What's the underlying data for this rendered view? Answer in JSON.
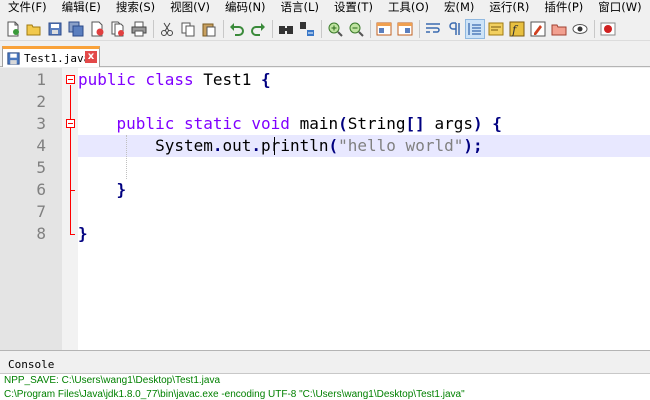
{
  "menu": [
    "文件(F)",
    "编辑(E)",
    "搜索(S)",
    "视图(V)",
    "编码(N)",
    "语言(L)",
    "设置(T)",
    "工具(O)",
    "宏(M)",
    "运行(R)",
    "插件(P)",
    "窗口(W)",
    "?"
  ],
  "toolbar": {
    "icons": [
      "new-file-icon",
      "open-file-icon",
      "save-icon",
      "save-all-icon",
      "close-icon",
      "close-all-icon",
      "print-icon",
      "cut-icon",
      "copy-icon",
      "paste-icon",
      "undo-icon",
      "redo-icon",
      "find-icon",
      "replace-icon",
      "zoom-in-icon",
      "zoom-out-icon",
      "sync-vertical-icon",
      "sync-horizontal-icon",
      "word-wrap-icon",
      "show-all-chars-icon",
      "indent-guide-icon",
      "user-language-icon",
      "function-list-icon",
      "folder-workspace-icon",
      "doc-map-icon",
      "monitor-icon",
      "record-macro-icon"
    ]
  },
  "tab": {
    "label": "Test1.java",
    "close_glyph": "x"
  },
  "editor": {
    "line_numbers": [
      "1",
      "2",
      "3",
      "4",
      "5",
      "6",
      "7",
      "8"
    ],
    "lines": [
      [
        {
          "t": "public class ",
          "c": "kw"
        },
        {
          "t": "Test1 ",
          "c": "cls"
        },
        {
          "t": "{",
          "c": "op"
        }
      ],
      [],
      [
        {
          "t": "    public static void ",
          "c": "kw"
        },
        {
          "t": "main",
          "c": "cls"
        },
        {
          "t": "(",
          "c": "op"
        },
        {
          "t": "String",
          "c": "cls"
        },
        {
          "t": "[] ",
          "c": "op"
        },
        {
          "t": "args",
          "c": "cls"
        },
        {
          "t": ") {",
          "c": "op"
        }
      ],
      [
        {
          "t": "        System",
          "c": "cls"
        },
        {
          "t": ".",
          "c": "op"
        },
        {
          "t": "out",
          "c": "cls"
        },
        {
          "t": ".",
          "c": "op"
        },
        {
          "t": "println",
          "c": "cls"
        },
        {
          "t": "(",
          "c": "op"
        },
        {
          "t": "\"hello world\"",
          "c": "str"
        },
        {
          "t": ");",
          "c": "op"
        }
      ],
      [],
      [
        {
          "t": "    }",
          "c": "op"
        }
      ],
      [],
      [
        {
          "t": "}",
          "c": "op"
        }
      ]
    ],
    "current_line": 4
  },
  "console": {
    "title": "Console",
    "lines": [
      "NPP_SAVE: C:\\Users\\wang1\\Desktop\\Test1.java",
      "C:\\Program Files\\Java\\jdk1.8.0_77\\bin\\javac.exe -encoding UTF-8 \"C:\\Users\\wang1\\Desktop\\Test1.java\""
    ],
    "text_color": "#008000"
  },
  "colors": {
    "keyword": "#8000ff",
    "string": "#808080",
    "operator": "#000080",
    "tab_accent": "#f9a23a",
    "fold_marker": "#ff0000"
  }
}
